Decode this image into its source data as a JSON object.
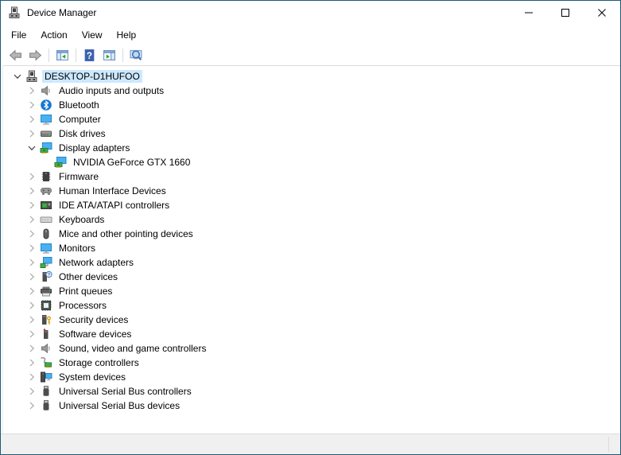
{
  "window": {
    "title": "Device Manager",
    "app_icon": "device-manager-icon"
  },
  "menu_bar": {
    "items": [
      {
        "label": "File"
      },
      {
        "label": "Action"
      },
      {
        "label": "View"
      },
      {
        "label": "Help"
      }
    ]
  },
  "toolbar": {
    "buttons": [
      {
        "name": "back",
        "icon": "arrow-left-icon",
        "enabled": false
      },
      {
        "name": "forward",
        "icon": "arrow-right-icon",
        "enabled": false
      },
      {
        "sep": true
      },
      {
        "name": "show-console-tree",
        "icon": "console-tree-icon",
        "enabled": true
      },
      {
        "sep": true
      },
      {
        "name": "help",
        "icon": "help-icon",
        "enabled": true
      },
      {
        "name": "properties",
        "icon": "properties-icon",
        "enabled": true
      },
      {
        "sep": true
      },
      {
        "name": "scan-for-hardware-changes",
        "icon": "scan-icon",
        "enabled": true
      }
    ]
  },
  "tree": {
    "items": [
      {
        "label": "DESKTOP-D1HUFOO",
        "icon": "computer-icon",
        "level": 0,
        "chevron": "expanded",
        "selected": true
      },
      {
        "label": "Audio inputs and outputs",
        "icon": "audio-icon",
        "level": 1,
        "chevron": "collapsed",
        "selected": false
      },
      {
        "label": "Bluetooth",
        "icon": "bluetooth-icon",
        "level": 1,
        "chevron": "collapsed",
        "selected": false
      },
      {
        "label": "Computer",
        "icon": "monitor-icon",
        "level": 1,
        "chevron": "collapsed",
        "selected": false
      },
      {
        "label": "Disk drives",
        "icon": "disk-icon",
        "level": 1,
        "chevron": "collapsed",
        "selected": false
      },
      {
        "label": "Display adapters",
        "icon": "display-adapter-icon",
        "level": 1,
        "chevron": "expanded",
        "selected": false
      },
      {
        "label": "NVIDIA GeForce GTX 1660",
        "icon": "display-adapter-icon",
        "level": 2,
        "chevron": "none",
        "selected": false
      },
      {
        "label": "Firmware",
        "icon": "firmware-icon",
        "level": 1,
        "chevron": "collapsed",
        "selected": false
      },
      {
        "label": "Human Interface Devices",
        "icon": "hid-icon",
        "level": 1,
        "chevron": "collapsed",
        "selected": false
      },
      {
        "label": "IDE ATA/ATAPI controllers",
        "icon": "ide-icon",
        "level": 1,
        "chevron": "collapsed",
        "selected": false
      },
      {
        "label": "Keyboards",
        "icon": "keyboard-icon",
        "level": 1,
        "chevron": "collapsed",
        "selected": false
      },
      {
        "label": "Mice and other pointing devices",
        "icon": "mouse-icon",
        "level": 1,
        "chevron": "collapsed",
        "selected": false
      },
      {
        "label": "Monitors",
        "icon": "monitor-icon",
        "level": 1,
        "chevron": "collapsed",
        "selected": false
      },
      {
        "label": "Network adapters",
        "icon": "network-icon",
        "level": 1,
        "chevron": "collapsed",
        "selected": false
      },
      {
        "label": "Other devices",
        "icon": "unknown-device-icon",
        "level": 1,
        "chevron": "collapsed",
        "selected": false
      },
      {
        "label": "Print queues",
        "icon": "printer-icon",
        "level": 1,
        "chevron": "collapsed",
        "selected": false
      },
      {
        "label": "Processors",
        "icon": "processor-icon",
        "level": 1,
        "chevron": "collapsed",
        "selected": false
      },
      {
        "label": "Security devices",
        "icon": "security-icon",
        "level": 1,
        "chevron": "collapsed",
        "selected": false
      },
      {
        "label": "Software devices",
        "icon": "software-icon",
        "level": 1,
        "chevron": "collapsed",
        "selected": false
      },
      {
        "label": "Sound, video and game controllers",
        "icon": "audio-icon",
        "level": 1,
        "chevron": "collapsed",
        "selected": false
      },
      {
        "label": "Storage controllers",
        "icon": "storage-icon",
        "level": 1,
        "chevron": "collapsed",
        "selected": false
      },
      {
        "label": "System devices",
        "icon": "system-icon",
        "level": 1,
        "chevron": "collapsed",
        "selected": false
      },
      {
        "label": "Universal Serial Bus controllers",
        "icon": "usb-icon",
        "level": 1,
        "chevron": "collapsed",
        "selected": false
      },
      {
        "label": "Universal Serial Bus devices",
        "icon": "usb-icon",
        "level": 1,
        "chevron": "collapsed",
        "selected": false
      }
    ]
  },
  "status_bar": {
    "text": ""
  },
  "colors": {
    "window_border": "#1d5a77",
    "titlebar_bg": "#ffffff",
    "selection_bg": "#cce8ff",
    "statusbar_bg": "#f0f0f0",
    "help_blue": "#3a63ae",
    "device_green": "#3fae49",
    "screen_blue": "#49b1f2"
  }
}
